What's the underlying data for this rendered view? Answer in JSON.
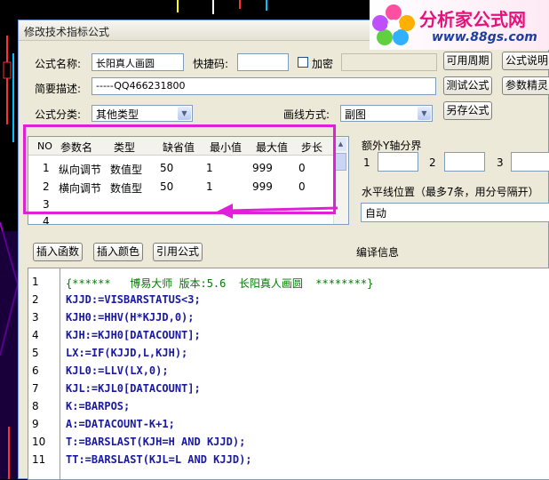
{
  "logo": {
    "title": "分析家公式网",
    "url": "www.88gs.com"
  },
  "dialog": {
    "title": "修改技术指标公式"
  },
  "form": {
    "name_label": "公式名称:",
    "name_value": "长阳真人画圆",
    "shortcut_label": "快捷码:",
    "shortcut_value": "",
    "encrypt_label": "加密",
    "desc_label": "简要描述:",
    "desc_value": "-----QQ466231800",
    "category_label": "公式分类:",
    "category_value": "其他类型",
    "linestyle_label": "画线方式:",
    "linestyle_value": "副图"
  },
  "buttons": {
    "period": "可用周期",
    "explain": "公式说明",
    "test": "测试公式",
    "tune": "参数精灵",
    "saveas": "另存公式",
    "insert_func": "插入函数",
    "insert_color": "插入颜色",
    "ref_formula": "引用公式"
  },
  "params": {
    "headers": [
      "NO",
      "参数名",
      "类型",
      "缺省值",
      "最小值",
      "最大值",
      "步长"
    ],
    "rows": [
      [
        "1",
        "纵向调节",
        "数值型",
        "50",
        "1",
        "999",
        "0"
      ],
      [
        "2",
        "横向调节",
        "数值型",
        "50",
        "1",
        "999",
        "0"
      ],
      [
        "3",
        "",
        "",
        "",
        "",
        "",
        ""
      ],
      [
        "4",
        "",
        "",
        "",
        "",
        "",
        ""
      ]
    ]
  },
  "yaxis": {
    "label": "额外Y轴分界",
    "f1": "1",
    "f2": "2",
    "f3": "3"
  },
  "hline": {
    "label": "水平线位置（最多7条，用分号隔开）",
    "value": "自动"
  },
  "compile_label": "编译信息",
  "code_lines": [
    "{******   博易大师 版本:5.6  长阳真人画圆  ********}",
    "KJJD:=VISBARSTATUS<3;",
    "KJH0:=HHV(H*KJJD,0);",
    "KJH:=KJH0[DATACOUNT];",
    "LX:=IF(KJJD,L,KJH);",
    "KJL0:=LLV(LX,0);",
    "KJL:=KJL0[DATACOUNT];",
    "K:=BARPOS;",
    "A:=DATACOUNT-K+1;",
    "T:=BARSLAST(KJH=H AND KJJD);",
    "TT:=BARSLAST(KJL=L AND KJJD);"
  ],
  "colors": {
    "highlight": "#e020d8",
    "code_keyword": "#1a1aa0",
    "code_comment": "#007a00"
  }
}
